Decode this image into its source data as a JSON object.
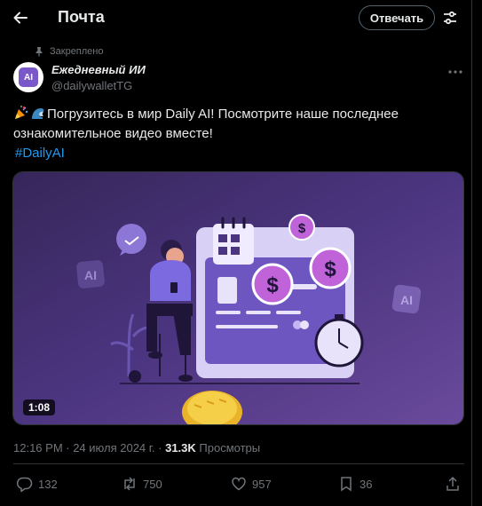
{
  "header": {
    "title": "Почта",
    "reply_label": "Отвечать"
  },
  "tweet": {
    "pinned_label": "Закреплено",
    "author_name": "Ежедневный ИИ",
    "author_handle": "@dailywalletTG",
    "avatar_text": "AI",
    "text": "Погрузитесь в мир Daily AI! Посмотрите наше последнее ознакомительное видео вместе!",
    "hashtag": "#DailyAI",
    "video_duration": "1:08",
    "media_badge_left": "AI",
    "media_badge_right": "AI",
    "timestamp": "12:16 PM · 24 июля 2024 г. · ",
    "views_count": "31.3K",
    "views_label": " Просмотры"
  },
  "actions": {
    "replies": "132",
    "reposts": "750",
    "likes": "957",
    "bookmarks": "36"
  },
  "colors": {
    "accent": "#1d9bf0",
    "muted": "#71767b",
    "brand_purple": "#7b58c9"
  }
}
